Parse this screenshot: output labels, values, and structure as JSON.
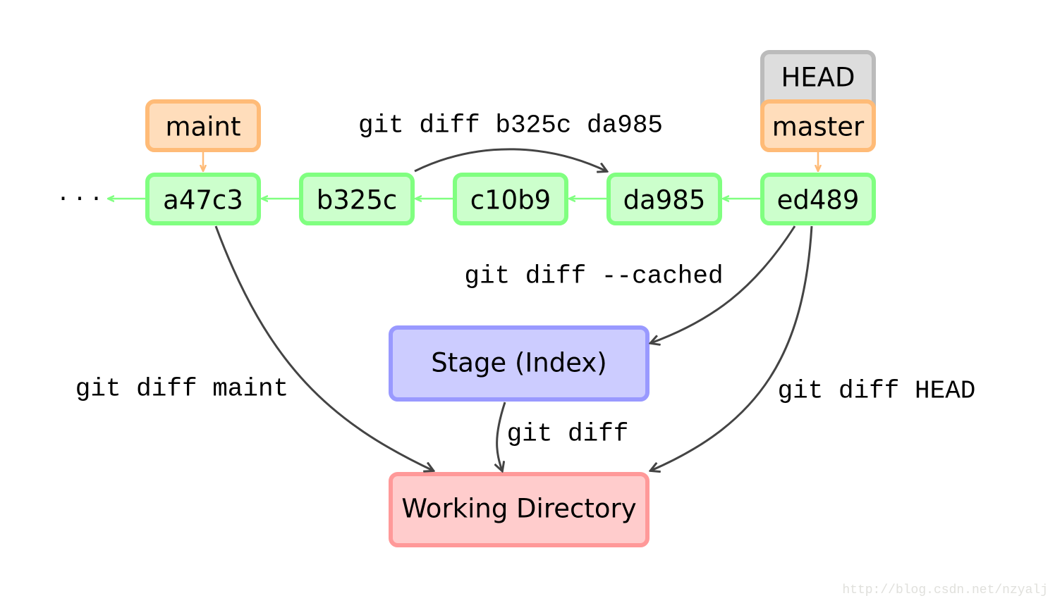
{
  "colors": {
    "commit_fill": "#ccffcc",
    "commit_stroke": "#80ff80",
    "branch_fill": "#ffddbb",
    "branch_stroke": "#ffbb77",
    "head_fill": "#dddddd",
    "head_stroke": "#bbbbbb",
    "stage_fill": "#ccccff",
    "stage_stroke": "#9999ff",
    "wd_fill": "#ffcccc",
    "wd_stroke": "#ff9999",
    "arrow": "#444444"
  },
  "ellipsis": "· · ·",
  "commits": [
    "a47c3",
    "b325c",
    "c10b9",
    "da985",
    "ed489"
  ],
  "branches": {
    "maint": "maint",
    "master": "master",
    "head": "HEAD"
  },
  "stage": "Stage (Index)",
  "working_directory": "Working Directory",
  "commands": {
    "between_commits": "git diff b325c da985",
    "cached": "git diff --cached",
    "maint": "git diff maint",
    "head": "git diff HEAD",
    "plain": "git diff"
  },
  "watermark": "http://blog.csdn.net/nzyalj"
}
